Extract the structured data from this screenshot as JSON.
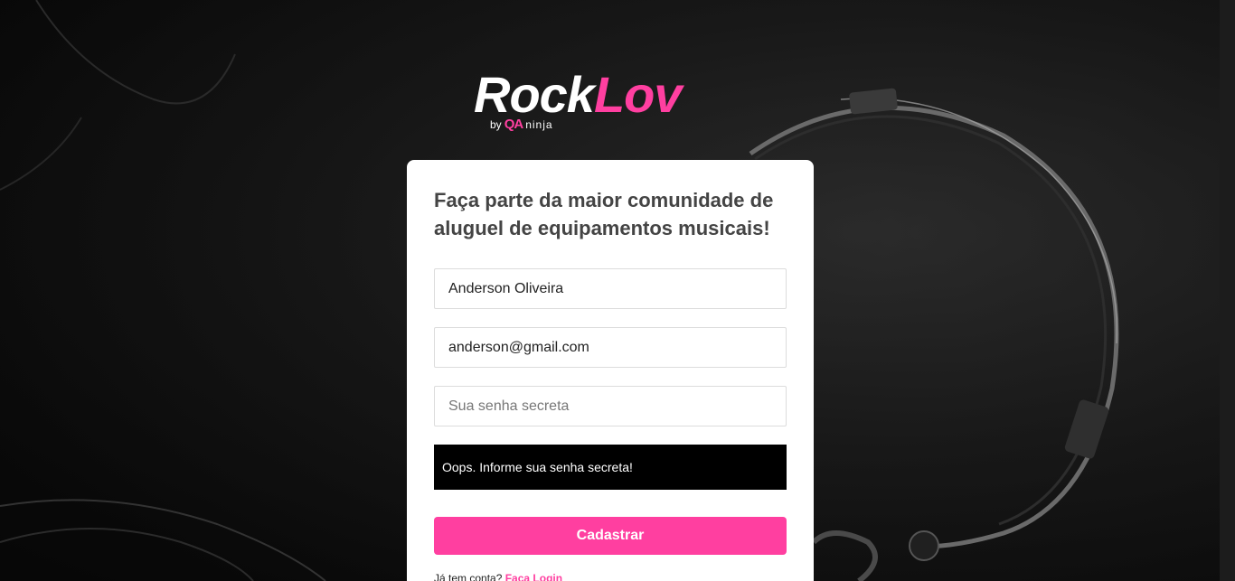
{
  "brand": {
    "name_part1": "Rock",
    "name_part2": "Lov",
    "by_text": "by",
    "qa_text": "QA",
    "ninja_text": "ninja",
    "accent_color": "#ff3fa0"
  },
  "signup": {
    "title": "Faça parte da maior comunidade de aluguel de equipamentos musicais!",
    "name_value": "Anderson Oliveira",
    "email_value": "anderson@gmail.com",
    "password_placeholder": "Sua senha secreta",
    "alert_message": "Oops. Informe sua senha secreta!",
    "submit_label": "Cadastrar",
    "login_prompt": "Já tem conta?",
    "login_link": "Faça Login"
  },
  "background": {
    "image_subject": "headphones-photo"
  }
}
